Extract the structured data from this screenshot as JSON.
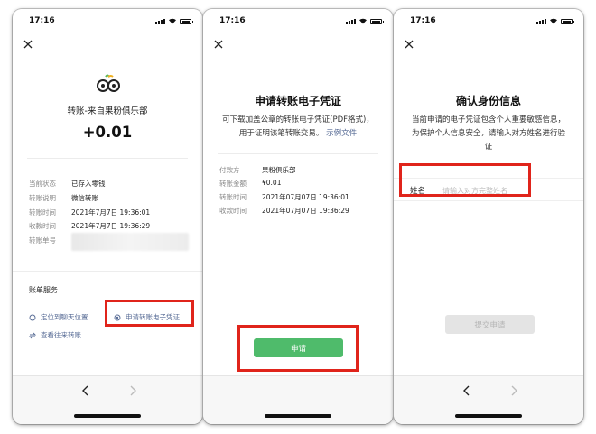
{
  "status_bar": {
    "time": "17:16"
  },
  "screen1": {
    "merchant_label": "转账-来自果粉俱乐部",
    "amount": "+0.01",
    "details": [
      {
        "label": "当前状态",
        "value": "已存入零钱"
      },
      {
        "label": "转账说明",
        "value": "微信转账"
      },
      {
        "label": "转账时间",
        "value": "2021年7月7日 19:36:01"
      },
      {
        "label": "收款时间",
        "value": "2021年7月7日 19:36:29"
      },
      {
        "label": "转账单号",
        "value": ""
      }
    ],
    "services_title": "账单服务",
    "locate_label": "定位到聊天位置",
    "apply_voucher_label": "申请转账电子凭证",
    "history_label": "查看往来转账"
  },
  "screen2": {
    "title": "申请转账电子凭证",
    "description": "可下载加盖公章的转账电子凭证(PDF格式)，用于证明该笔转账交易。",
    "example_link": "示例文件",
    "details": [
      {
        "label": "付款方",
        "value": "果粉俱乐部"
      },
      {
        "label": "转账金额",
        "value": "¥0.01"
      },
      {
        "label": "转账时间",
        "value": "2021年07月07日 19:36:01"
      },
      {
        "label": "收款时间",
        "value": "2021年07月07日 19:36:29"
      }
    ],
    "apply_button": "申请"
  },
  "screen3": {
    "title": "确认身份信息",
    "description": "当前申请的电子凭证包含个人重要敏感信息，为保护个人信息安全，请输入对方姓名进行验证",
    "name_label": "姓名",
    "name_value": "",
    "name_placeholder": "请输入对方完整姓名",
    "submit_button": "提交申请"
  },
  "colors": {
    "highlight": "#e0241b",
    "primary_green": "#4fbb6b",
    "link_blue": "#576b95"
  }
}
